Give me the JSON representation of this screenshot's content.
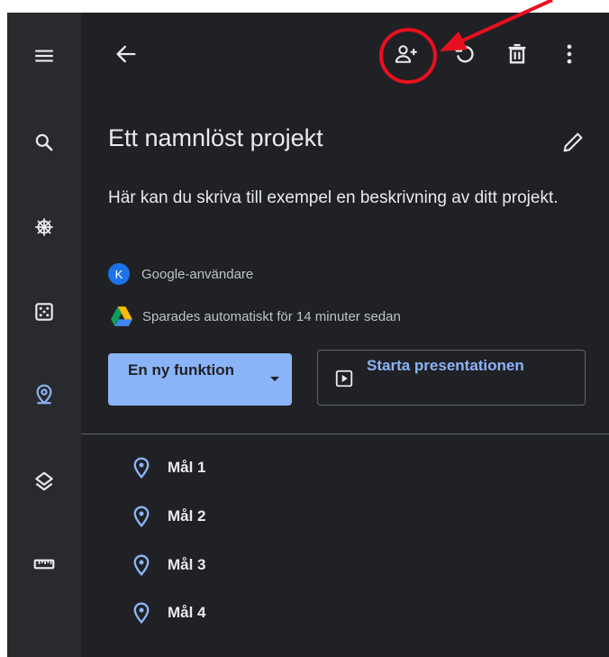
{
  "project": {
    "title": "Ett namnlöst projekt",
    "description": "Här kan du skriva till exempel en beskrivning av ditt projekt.",
    "owner_initial": "K",
    "owner_name": "Google-användare",
    "saved_status": "Sparades automatiskt för 14 minuter sedan"
  },
  "actions": {
    "new_feature_label": "En ny funktion",
    "present_label": "Starta presentationen"
  },
  "goals": [
    "Mål 1",
    "Mål 2",
    "Mål 3",
    "Mål 4"
  ],
  "sidebar": {
    "items": [
      "menu-icon",
      "search-icon",
      "network-icon",
      "dice-icon",
      "map-pin-icon",
      "layers-icon",
      "ruler-icon"
    ]
  },
  "toolbar": {
    "icons": [
      "back-arrow-icon",
      "add-person-icon",
      "undo-icon",
      "trash-icon",
      "more-vert-icon"
    ]
  },
  "annotation": {
    "color": "#e8101f"
  },
  "colors": {
    "background": "#202124",
    "rail": "#292a2d",
    "accent": "#8ab4f8",
    "text": "#e8eaed"
  }
}
